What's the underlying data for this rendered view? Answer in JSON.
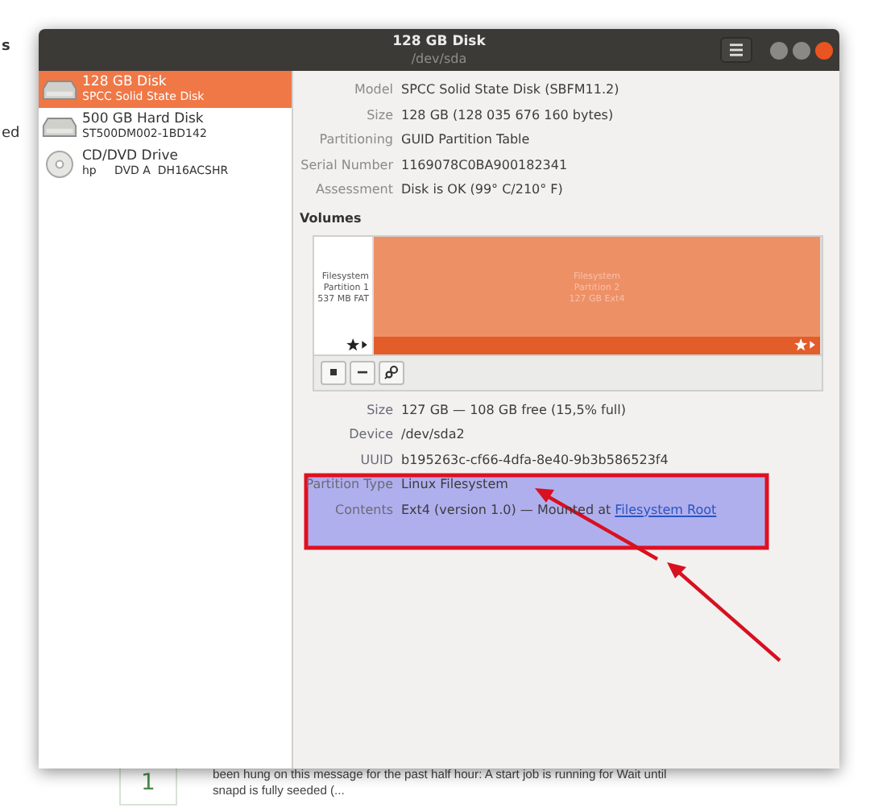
{
  "background": {
    "fragments": [
      "s",
      "ed"
    ],
    "answer_count": "1",
    "excerpt_lines": [
      "been hung on this message for the past half hour: A start job is running for Wait until",
      "snapd is fully seeded (..."
    ]
  },
  "window": {
    "title": "128 GB Disk",
    "subtitle": "/dev/sda"
  },
  "disks": [
    {
      "name": "128 GB Disk",
      "detail": "SPCC Solid State Disk",
      "kind": "drive",
      "selected": true
    },
    {
      "name": "500 GB Hard Disk",
      "detail": "ST500DM002-1BD142",
      "kind": "drive",
      "selected": false
    },
    {
      "name": "CD/DVD Drive",
      "detail": "hp     DVD A  DH16ACSHR",
      "kind": "optical",
      "selected": false
    }
  ],
  "drive_info": [
    {
      "label": "Model",
      "value": "SPCC Solid State Disk (SBFM11.2)"
    },
    {
      "label": "Size",
      "value": "128 GB (128 035 676 160 bytes)"
    },
    {
      "label": "Partitioning",
      "value": "GUID Partition Table"
    },
    {
      "label": "Serial Number",
      "value": "1169078C0BA900182341"
    },
    {
      "label": "Assessment",
      "value": "Disk is OK (99° C/210° F)"
    }
  ],
  "volumes_heading": "Volumes",
  "partitions": [
    {
      "lines": [
        "Filesystem",
        "Partition 1",
        "537 MB FAT"
      ],
      "selected": false
    },
    {
      "lines": [
        "Filesystem",
        "Partition 2",
        "127 GB Ext4"
      ],
      "selected": true
    }
  ],
  "volume_info": [
    {
      "label": "Size",
      "value": "127 GB — 108 GB free (15,5% full)"
    },
    {
      "label": "Device",
      "value": "/dev/sda2"
    },
    {
      "label": "UUID",
      "value": "b195263c-cf66-4dfa-8e40-9b3b586523f4"
    },
    {
      "label": "Partition Type",
      "value": "Linux Filesystem"
    },
    {
      "label": "Contents",
      "value": "Ext4 (version 1.0) — Mounted at ",
      "link": "Filesystem Root"
    }
  ]
}
